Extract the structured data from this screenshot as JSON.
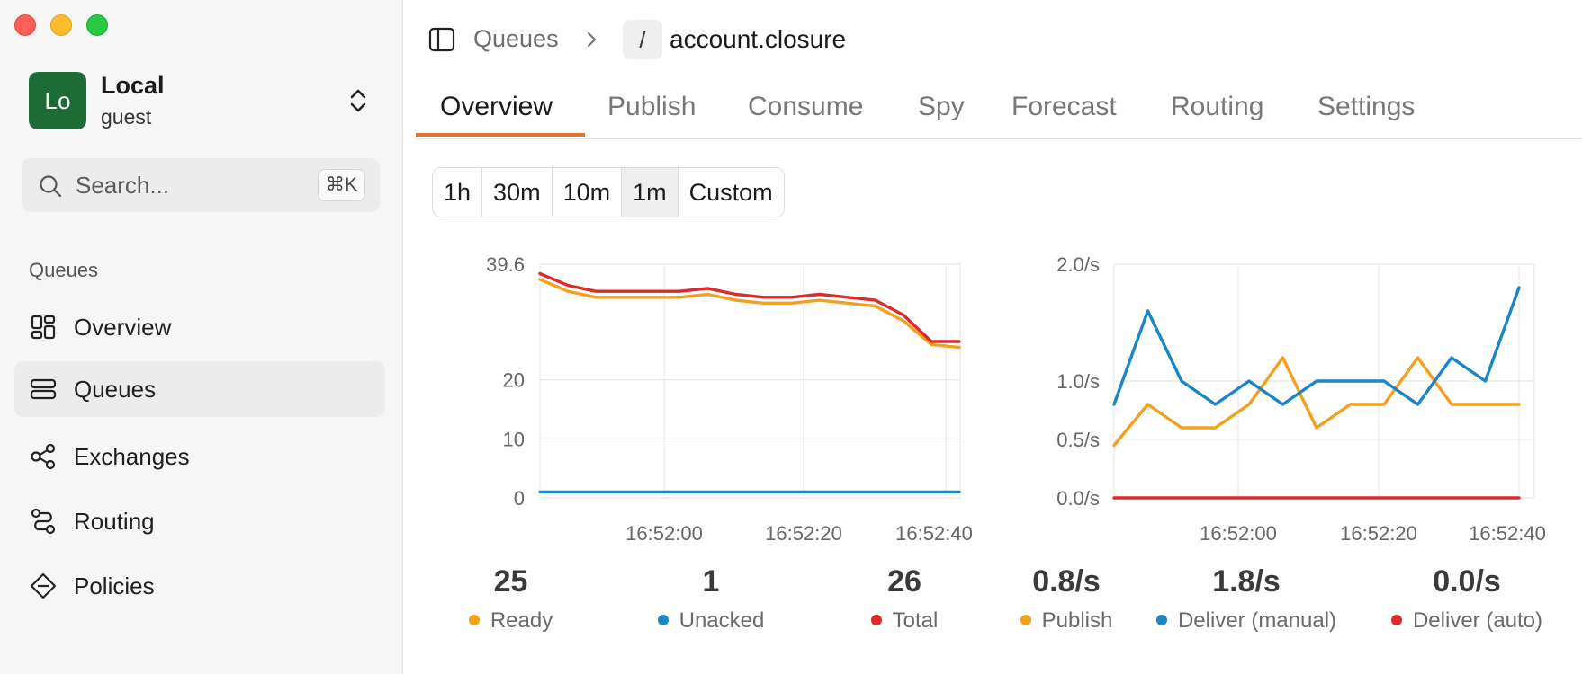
{
  "sidebar": {
    "account": {
      "initials": "Lo",
      "name": "Local",
      "user": "guest"
    },
    "search": {
      "placeholder": "Search...",
      "shortcut": "⌘K"
    },
    "section_title": "Queues",
    "items": [
      {
        "label": "Overview",
        "icon": "dashboard-icon",
        "active": false
      },
      {
        "label": "Queues",
        "icon": "queues-icon",
        "active": true
      },
      {
        "label": "Exchanges",
        "icon": "exchanges-icon",
        "active": false
      },
      {
        "label": "Routing",
        "icon": "routing-icon",
        "active": false
      },
      {
        "label": "Policies",
        "icon": "policies-icon",
        "active": false
      }
    ]
  },
  "header": {
    "breadcrumb": {
      "parent": "Queues",
      "vhost": "/",
      "queue": "account.closure"
    }
  },
  "tabs": [
    "Overview",
    "Publish",
    "Consume",
    "Spy",
    "Forecast",
    "Routing",
    "Settings"
  ],
  "active_tab": "Overview",
  "time_ranges": [
    "1h",
    "30m",
    "10m",
    "1m",
    "Custom"
  ],
  "active_range": "1m",
  "colors": {
    "ready": "#f2a01e",
    "unacked": "#1b86c6",
    "total": "#dc2b2b",
    "accent": "#e8742b"
  },
  "stats": [
    {
      "value": "25",
      "label": "Ready",
      "color": "#f2a01e"
    },
    {
      "value": "1",
      "label": "Unacked",
      "color": "#1b86c6"
    },
    {
      "value": "26",
      "label": "Total",
      "color": "#dc2b2b"
    },
    {
      "value": "0.8/s",
      "label": "Publish",
      "color": "#f2a01e"
    },
    {
      "value": "1.8/s",
      "label": "Deliver (manual)",
      "color": "#1b86c6"
    },
    {
      "value": "0.0/s",
      "label": "Deliver (auto)",
      "color": "#dc2b2b"
    }
  ],
  "chart_data": [
    {
      "type": "line",
      "ylim": [
        0,
        39.6
      ],
      "y_ticks": [
        "0",
        "10",
        "20",
        "39.6"
      ],
      "x_ticks": [
        "16:52:00",
        "16:52:20",
        "16:52:40"
      ],
      "x_start": "16:51:42",
      "x_end": "16:52:42",
      "grid": true,
      "series": [
        {
          "name": "Ready",
          "color": "#f2a01e",
          "values": [
            37,
            35,
            34,
            34,
            34,
            34,
            34.5,
            33.5,
            33,
            33,
            33.5,
            33,
            32.5,
            30,
            26,
            25.5
          ]
        },
        {
          "name": "Unacked",
          "color": "#1b86c6",
          "values": [
            1,
            1,
            1,
            1,
            1,
            1,
            1,
            1,
            1,
            1,
            1,
            1,
            1,
            1,
            1,
            1
          ]
        },
        {
          "name": "Total",
          "color": "#dc2b2b",
          "values": [
            38,
            36,
            35,
            35,
            35,
            35,
            35.5,
            34.5,
            34,
            34,
            34.5,
            34,
            33.5,
            31,
            26.5,
            26.5
          ]
        }
      ]
    },
    {
      "type": "line",
      "ylim": [
        0,
        2.0
      ],
      "y_ticks": [
        "0.0/s",
        "0.5/s",
        "1.0/s",
        "2.0/s"
      ],
      "x_ticks": [
        "16:52:00",
        "16:52:20",
        "16:52:40"
      ],
      "grid": true,
      "series": [
        {
          "name": "Publish",
          "color": "#f2a01e",
          "values": [
            0.45,
            0.8,
            0.6,
            0.6,
            0.8,
            1.2,
            0.6,
            0.8,
            0.8,
            1.2,
            0.8,
            0.8,
            0.8
          ]
        },
        {
          "name": "Deliver (manual)",
          "color": "#1b86c6",
          "values": [
            0.8,
            1.6,
            1.0,
            0.8,
            1.0,
            0.8,
            1.0,
            1.0,
            1.0,
            0.8,
            1.2,
            1.0,
            1.8
          ]
        },
        {
          "name": "Deliver (auto)",
          "color": "#dc2b2b",
          "values": [
            0,
            0,
            0,
            0,
            0,
            0,
            0,
            0,
            0,
            0,
            0,
            0,
            0
          ]
        }
      ]
    }
  ]
}
